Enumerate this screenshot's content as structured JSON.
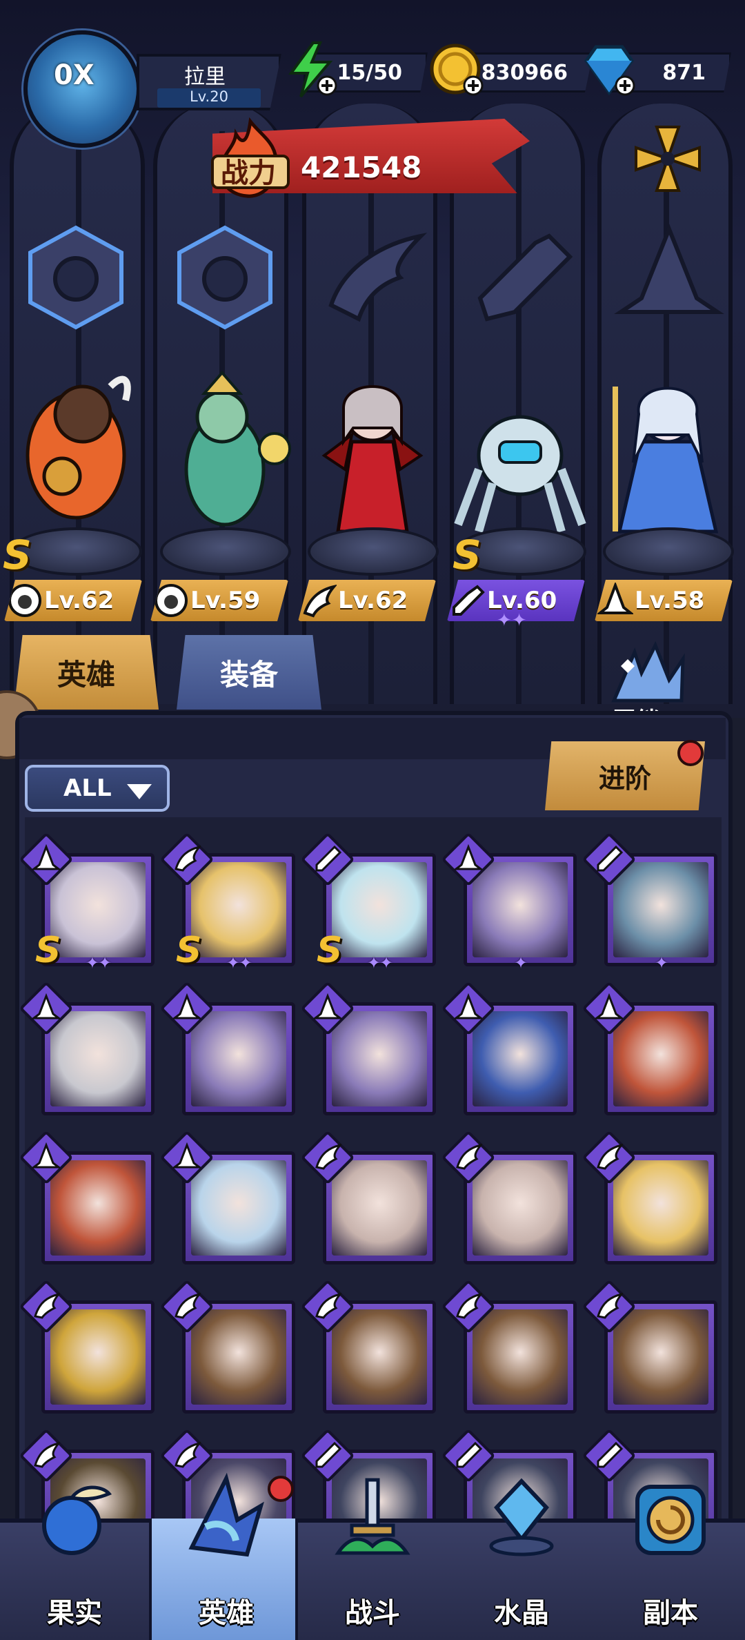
{
  "player": {
    "name": "拉里",
    "level": "Lv.20",
    "avatar_badge": "0X"
  },
  "resources": {
    "energy": "15/50",
    "gold": "830966",
    "diamonds": "871"
  },
  "power": {
    "label": "战力",
    "value": "421548"
  },
  "team_classes": [
    "beast-crest",
    "beast-crest",
    "wing-crest",
    "wrench-crest",
    "mage-hat-crest"
  ],
  "team": [
    {
      "name": "minotaur",
      "level": "Lv.62",
      "rank": "S",
      "class": "beast",
      "tag_color": "#d9a147"
    },
    {
      "name": "medusa",
      "level": "Lv.59",
      "rank": "",
      "class": "beast",
      "tag_color": "#d9a147"
    },
    {
      "name": "vampire",
      "level": "Lv.62",
      "rank": "",
      "class": "wing",
      "tag_color": "#d9a147"
    },
    {
      "name": "mech-spider",
      "level": "Lv.60",
      "rank": "S",
      "class": "wrench",
      "tag_color": "#6a44d4",
      "stars": "✦✦"
    },
    {
      "name": "ice-queen",
      "level": "Lv.58",
      "rank": "",
      "class": "mage",
      "tag_color": "#d9a147"
    }
  ],
  "tabs": [
    {
      "label": "英雄",
      "active": true
    },
    {
      "label": "装备",
      "active": false
    }
  ],
  "bond_label": "羁绊",
  "filter_label": "ALL",
  "advance_label": "进阶",
  "rows": [
    [
      {
        "rank": "S",
        "stars": "✦✦",
        "class": "mage",
        "hue": "#c9c2d6"
      },
      {
        "rank": "S",
        "stars": "✦✦",
        "class": "wing",
        "hue": "#e6c26b"
      },
      {
        "rank": "S",
        "stars": "✦✦",
        "class": "wrench",
        "hue": "#bfe3ee"
      },
      {
        "rank": "",
        "stars": "✦",
        "class": "mage",
        "hue": "#8a7bb8"
      },
      {
        "rank": "",
        "stars": "✦",
        "class": "wrench",
        "hue": "#6c8fa8"
      }
    ],
    [
      {
        "rank": "",
        "stars": "",
        "class": "mage",
        "hue": "#c8c8cf"
      },
      {
        "rank": "",
        "stars": "",
        "class": "mage",
        "hue": "#8a7bb8"
      },
      {
        "rank": "",
        "stars": "",
        "class": "mage",
        "hue": "#8a7bb8"
      },
      {
        "rank": "",
        "stars": "",
        "class": "mage",
        "hue": "#3f5db0"
      },
      {
        "rank": "",
        "stars": "",
        "class": "mage",
        "hue": "#c0553a"
      }
    ],
    [
      {
        "rank": "",
        "stars": "",
        "class": "mage",
        "hue": "#c0553a"
      },
      {
        "rank": "",
        "stars": "",
        "class": "mage",
        "hue": "#b9d4ea"
      },
      {
        "rank": "",
        "stars": "",
        "class": "wing",
        "hue": "#c8b3ad"
      },
      {
        "rank": "",
        "stars": "",
        "class": "wing",
        "hue": "#c8b3ad"
      },
      {
        "rank": "",
        "stars": "",
        "class": "wing",
        "hue": "#e7c266"
      }
    ],
    [
      {
        "rank": "",
        "stars": "",
        "class": "wing",
        "hue": "#cfa53b"
      },
      {
        "rank": "",
        "stars": "",
        "class": "wing",
        "hue": "#7d5a3c"
      },
      {
        "rank": "",
        "stars": "",
        "class": "wing",
        "hue": "#7d5a3c"
      },
      {
        "rank": "",
        "stars": "",
        "class": "wing",
        "hue": "#7d5a3c"
      },
      {
        "rank": "",
        "stars": "",
        "class": "wing",
        "hue": "#7d5a3c"
      }
    ],
    [
      {
        "rank": "",
        "stars": "",
        "class": "wing",
        "hue": "#5a4a33"
      },
      {
        "rank": "",
        "stars": "",
        "class": "wing",
        "hue": "#4b4868"
      },
      {
        "rank": "",
        "stars": "",
        "class": "wrench",
        "hue": "#3f4560"
      },
      {
        "rank": "",
        "stars": "",
        "class": "wrench",
        "hue": "#3f4560"
      },
      {
        "rank": "",
        "stars": "",
        "class": "wrench",
        "hue": "#3f4560"
      }
    ]
  ],
  "nav": [
    {
      "label": "果实",
      "icon": "fruit-icon",
      "active": false
    },
    {
      "label": "英雄",
      "icon": "hero-wizard-icon",
      "active": true,
      "badge": true
    },
    {
      "label": "战斗",
      "icon": "battle-sword-icon",
      "active": false
    },
    {
      "label": "水晶",
      "icon": "crystal-icon",
      "active": false
    },
    {
      "label": "副本",
      "icon": "dungeon-portal-icon",
      "active": false
    }
  ],
  "colors": {
    "gold_tag": "#d9a147",
    "purple_tag": "#6a44d4",
    "card_purple": "#6a47bf",
    "power_red": "#c2302e",
    "notify_red": "#e23a3a"
  }
}
